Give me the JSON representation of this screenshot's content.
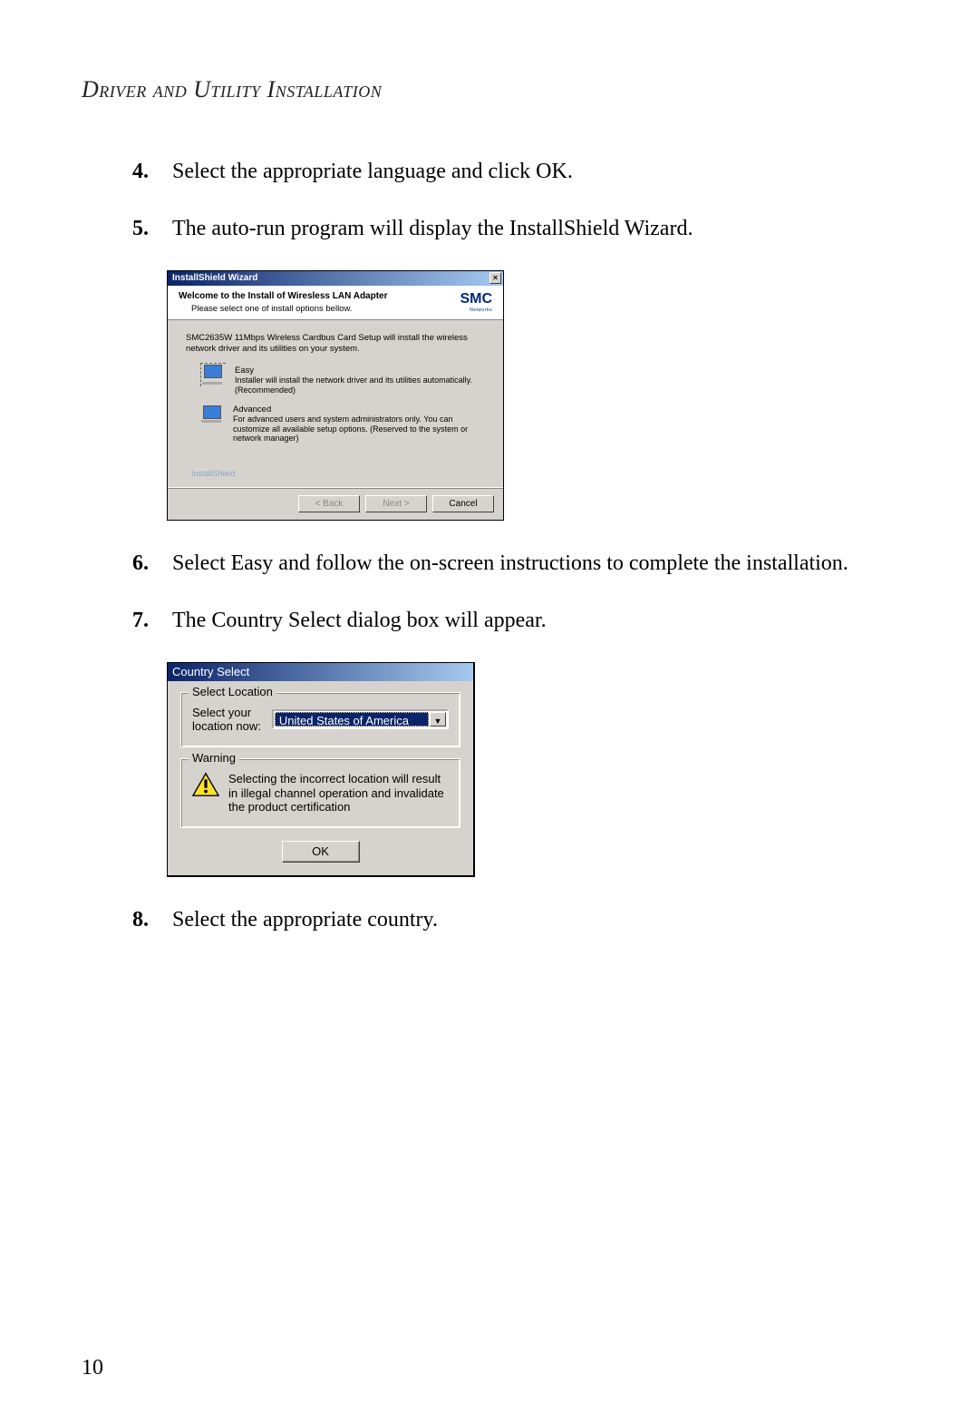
{
  "heading": "Driver and Utility Installation",
  "steps": {
    "s4": {
      "n": "4.",
      "t": "Select the appropriate language and click OK."
    },
    "s5": {
      "n": "5.",
      "t": "The auto-run program will display the InstallShield Wizard."
    },
    "s6": {
      "n": "6.",
      "t": "Select Easy and follow the on-screen instructions to complete the installation."
    },
    "s7": {
      "n": "7.",
      "t": "The Country Select dialog box will appear."
    },
    "s8": {
      "n": "8.",
      "t": "Select the appropriate country."
    }
  },
  "isw": {
    "title": "InstallShield Wizard",
    "close": "×",
    "header_title": "Welcome to the Install of Wiresless LAN Adapter",
    "header_sub": "Please select one of install options bellow.",
    "logo": "SMC",
    "logo_sub": "Networks",
    "intro": "SMC2635W 11Mbps Wireless Cardbus Card Setup will install the wireless network driver and its utilities on your system.",
    "opt_easy_title": "Easy",
    "opt_easy_desc": "Installer will install the network driver and its utilities automatically. (Recommended)",
    "opt_adv_title": "Advanced",
    "opt_adv_desc": "For advanced users and system administrators only. You can customize all available setup options. (Reserved to the system or network manager)",
    "installshield_brand": "InstallShield",
    "btn_back": "< Back",
    "btn_next": "Next >",
    "btn_cancel": "Cancel"
  },
  "cs": {
    "title": "Country Select",
    "legend_location": "Select Location",
    "label_location": "Select your location now:",
    "selected": "United States of America",
    "legend_warning": "Warning",
    "warning_text": "Selecting the incorrect location will result in illegal channel operation and invalidate the product certification",
    "ok": "OK"
  },
  "page_number": "10"
}
